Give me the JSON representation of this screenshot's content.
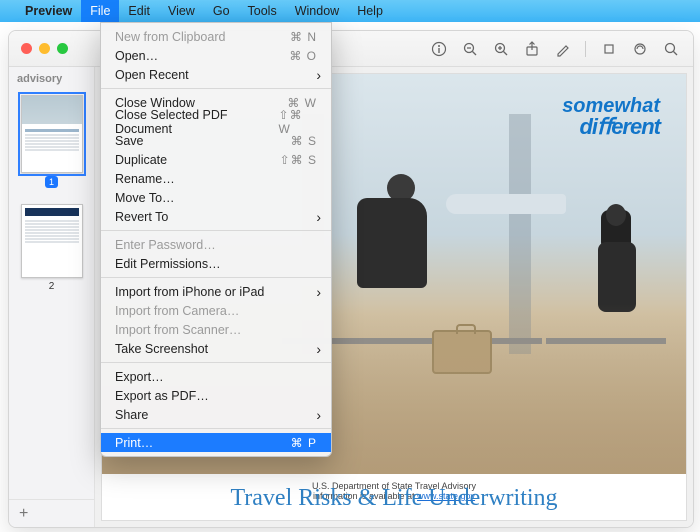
{
  "menubar": {
    "apple": "",
    "app": "Preview",
    "items": [
      "File",
      "Edit",
      "View",
      "Go",
      "Tools",
      "Window",
      "Help"
    ]
  },
  "file_menu": {
    "new_from_clipboard": {
      "label": "New from Clipboard",
      "sc": "⌘ N",
      "disabled": true
    },
    "open": {
      "label": "Open…",
      "sc": "⌘ O"
    },
    "open_recent": {
      "label": "Open Recent",
      "submenu": true
    },
    "close_window": {
      "label": "Close Window",
      "sc": "⌘ W"
    },
    "close_selected": {
      "label": "Close Selected PDF Document",
      "sc": "⇧⌘ W"
    },
    "save": {
      "label": "Save",
      "sc": "⌘ S"
    },
    "duplicate": {
      "label": "Duplicate",
      "sc": "⇧⌘ S"
    },
    "rename": {
      "label": "Rename…"
    },
    "move_to": {
      "label": "Move To…"
    },
    "revert_to": {
      "label": "Revert To",
      "submenu": true
    },
    "enter_password": {
      "label": "Enter Password…",
      "disabled": true
    },
    "edit_permissions": {
      "label": "Edit Permissions…"
    },
    "import_iphone": {
      "label": "Import from iPhone or iPad",
      "submenu": true
    },
    "import_camera": {
      "label": "Import from Camera…",
      "disabled": true
    },
    "import_scanner": {
      "label": "Import from Scanner…",
      "disabled": true
    },
    "take_screenshot": {
      "label": "Take Screenshot",
      "submenu": true
    },
    "export": {
      "label": "Export…"
    },
    "export_pdf": {
      "label": "Export as PDF…"
    },
    "share": {
      "label": "Share",
      "submenu": true
    },
    "print": {
      "label": "Print…",
      "sc": "⌘ P"
    }
  },
  "sidebar": {
    "title": "advisory",
    "pages": [
      {
        "num_badge": "1"
      },
      {
        "num": "2"
      }
    ],
    "add": "+"
  },
  "document": {
    "brand_l1": "somewhat",
    "brand_l2": "diﬀerent",
    "caption_line1": "U.S. Department of State Travel Advisory",
    "caption_line2_prefix": "information is available at ",
    "caption_link": "www.state.gov",
    "title": "Travel Risks & Life Underwriting"
  },
  "toolbar_icons": [
    "info",
    "zoom-out",
    "zoom-in",
    "share",
    "markup",
    "sep",
    "rotate",
    "highlight",
    "search"
  ]
}
